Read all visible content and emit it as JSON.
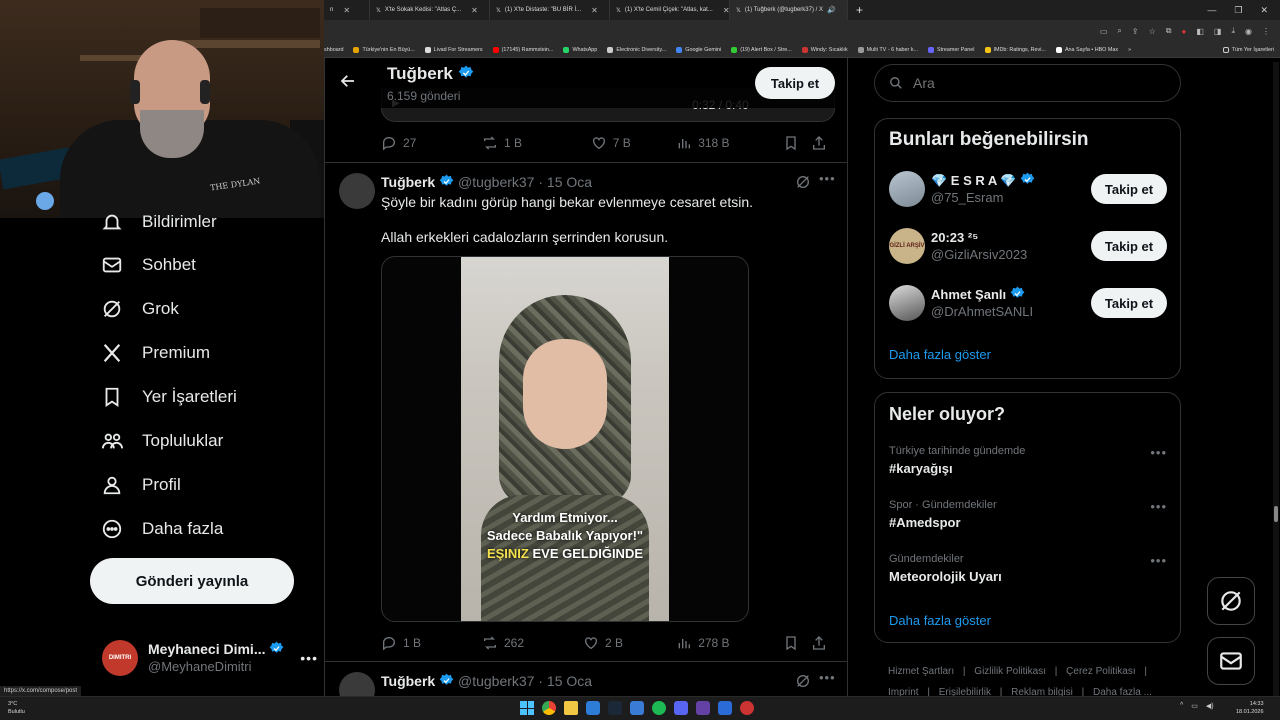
{
  "browser": {
    "tabs": [
      {
        "label": "n"
      },
      {
        "label": "X'te Sokak Kedisi: \"Atlas Ç..."
      },
      {
        "label": "(1) X'te Distaste: \"BU BİR İ..."
      },
      {
        "label": "(1) X'te Cemil Çiçek: \"Atlas, kat..."
      },
      {
        "label": "(1) Tuğberk (@tugberk37) / X",
        "active": true
      }
    ],
    "bookmarks": [
      "shboard",
      "Türkiye'nin En Büyü...",
      "Livad For Streamers",
      "(17145) Rammstein...",
      "WhatsApp",
      "Electronic Diversity...",
      "Google Gemini",
      "(19) Alert Box / Stre...",
      "Windy: Sıcaklık",
      "Multi TV - 6 haber k...",
      "Streamer Panel",
      "IMDb: Ratings, Revi...",
      "Ana Sayfa • HBO Max",
      "»",
      "Tüm Yer İşaretleri"
    ]
  },
  "webcam": {
    "cap_text": "THE DYLAN"
  },
  "sidebar": {
    "items": [
      {
        "label": "Bildirimler",
        "icon": "bell-icon"
      },
      {
        "label": "Sohbet",
        "icon": "mail-icon"
      },
      {
        "label": "Grok",
        "icon": "grok-icon"
      },
      {
        "label": "Premium",
        "icon": "x-logo-icon"
      },
      {
        "label": "Yer İşaretleri",
        "icon": "bookmark-icon"
      },
      {
        "label": "Topluluklar",
        "icon": "communities-icon"
      },
      {
        "label": "Profil",
        "icon": "profile-icon"
      },
      {
        "label": "Daha fazla",
        "icon": "more-circle-icon"
      }
    ],
    "post_button": "Gönderi yayınla",
    "account": {
      "name": "Meyhaneci Dimi...",
      "handle": "@MeyhaneDimitri",
      "avatar_text": "DIMITRI"
    }
  },
  "profile_header": {
    "name": "Tuğberk",
    "posts": "6.159 gönderi",
    "follow": "Takip et"
  },
  "prev_video_controls": {
    "time": "0:32 / 0:40"
  },
  "prev_tweet_actions": {
    "replies": "27",
    "reposts": "1 B",
    "likes": "7 B",
    "views": "318 B"
  },
  "tweet1": {
    "name": "Tuğberk",
    "handle": "@tugberk37",
    "date": "· 15 Oca",
    "line1": "Şöyle bir kadını görüp hangi bekar evlenmeye cesaret etsin.",
    "line2": "Allah erkekleri cadalozların şerrinden korusun.",
    "caption1": "Yardım Etmiyor...",
    "caption2": "Sadece Babalık Yapıyor!\"",
    "caption3a": "EŞINIZ",
    "caption3b": " EVE GELDIĞINDE",
    "replies": "1 B",
    "reposts": "262",
    "likes": "2 B",
    "views": "278 B"
  },
  "tweet2": {
    "name": "Tuğberk",
    "handle": "@tugberk37",
    "date": "· 15 Oca"
  },
  "search": {
    "placeholder": "Ara"
  },
  "suggestions": {
    "title": "Bunları beğenebilirsin",
    "users": [
      {
        "name": "💎 E S R A 💎",
        "handle": "@75_Esram",
        "verified": true,
        "follow": "Takip et"
      },
      {
        "name": "20:23 ²⁵",
        "handle": "@GizliArsiv2023",
        "verified": false,
        "follow": "Takip et",
        "avatar_text": "GİZLİ ARŞİV"
      },
      {
        "name": "Ahmet Şanlı",
        "handle": "@DrAhmetSANLI",
        "verified": true,
        "follow": "Takip et"
      }
    ],
    "more": "Daha fazla göster"
  },
  "trends": {
    "title": "Neler oluyor?",
    "items": [
      {
        "context": "Türkiye tarihinde gündemde",
        "name": "#karyağışı"
      },
      {
        "context": "Spor · Gündemdekiler",
        "name": "#Amedspor"
      },
      {
        "context": "Gündemdekiler",
        "name": "Meteorolojik Uyarı"
      }
    ],
    "more": "Daha fazla göster"
  },
  "footer_links": [
    "Hizmet Şartları",
    "Gizlilik Politikası",
    "Çerez Politikası",
    "Imprint",
    "Erişilebilirlik",
    "Reklam bilgisi",
    "Daha fazla ..."
  ],
  "status_url": "https://x.com/compose/post",
  "taskbar": {
    "weather_temp": "3°C",
    "weather_desc": "Bulutlu",
    "time": "14:33",
    "date": "18.01.2026"
  },
  "colors": {
    "accent": "#1d9bf0",
    "verified": "#1d9bf0",
    "background": "#000000",
    "border": "#2f3336",
    "muted": "#71767b"
  }
}
